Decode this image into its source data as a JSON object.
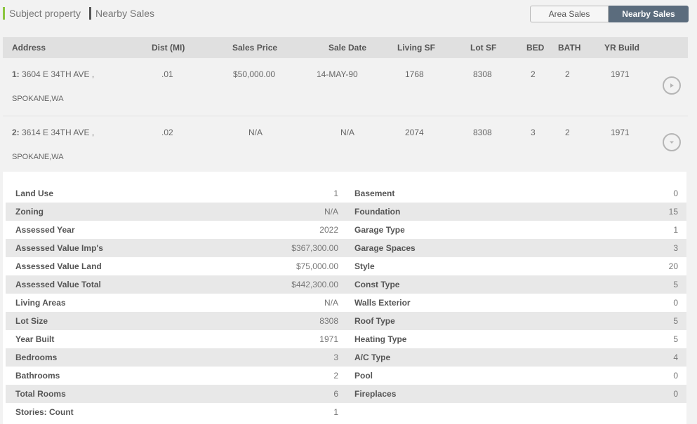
{
  "legend": {
    "subject": "Subject property",
    "nearby": "Nearby Sales",
    "subject_color": "#8cc63f",
    "nearby_color": "#555555"
  },
  "toggle": {
    "area": "Area Sales",
    "nearby": "Nearby Sales"
  },
  "table": {
    "headers": [
      "Address",
      "Dist (MI)",
      "Sales Price",
      "Sale Date",
      "Living SF",
      "Lot SF",
      "BED",
      "BATH",
      "YR Build"
    ],
    "rows": [
      {
        "index": "1:",
        "street": "3604 E 34TH AVE ,",
        "city": "SPOKANE,WA",
        "dist": ".01",
        "price": "$50,000.00",
        "date": "14-MAY-90",
        "living": "1768",
        "lot": "8308",
        "bed": "2",
        "bath": "2",
        "year": "1971",
        "icon": "play-circle-icon"
      },
      {
        "index": "2:",
        "street": "3614 E 34TH AVE ,",
        "city": "SPOKANE,WA",
        "dist": ".02",
        "price": "N/A",
        "date": "N/A",
        "living": "2074",
        "lot": "8308",
        "bed": "3",
        "bath": "2",
        "year": "1971",
        "icon": "chevron-down-circle-icon"
      }
    ]
  },
  "details": [
    {
      "label": "Land Use",
      "value": "1",
      "label2": "Basement",
      "value2": "0"
    },
    {
      "label": "Zoning",
      "value": "N/A",
      "label2": "Foundation",
      "value2": "15"
    },
    {
      "label": "Assessed Year",
      "value": "2022",
      "label2": "Garage Type",
      "value2": "1"
    },
    {
      "label": "Assessed Value Imp's",
      "value": "$367,300.00",
      "label2": "Garage Spaces",
      "value2": "3"
    },
    {
      "label": "Assessed Value Land",
      "value": "$75,000.00",
      "label2": "Style",
      "value2": "20"
    },
    {
      "label": "Assessed Value Total",
      "value": "$442,300.00",
      "label2": "Const Type",
      "value2": "5"
    },
    {
      "label": "Living Areas",
      "value": "N/A",
      "label2": "Walls Exterior",
      "value2": "0"
    },
    {
      "label": "Lot Size",
      "value": "8308",
      "label2": "Roof Type",
      "value2": "5"
    },
    {
      "label": "Year Built",
      "value": "1971",
      "label2": "Heating Type",
      "value2": "5"
    },
    {
      "label": "Bedrooms",
      "value": "3",
      "label2": "A/C Type",
      "value2": "4"
    },
    {
      "label": "Bathrooms",
      "value": "2",
      "label2": "Pool",
      "value2": "0"
    },
    {
      "label": "Total Rooms",
      "value": "6",
      "label2": "Fireplaces",
      "value2": "0"
    },
    {
      "label": "Stories: Count",
      "value": "1",
      "label2": "",
      "value2": ""
    }
  ]
}
